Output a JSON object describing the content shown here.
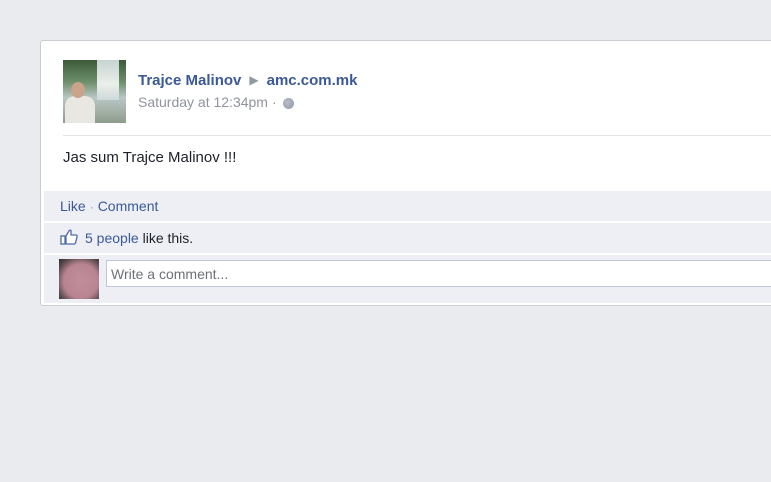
{
  "post": {
    "author": "Trajce Malinov",
    "target": "amc.com.mk",
    "timestamp": "Saturday at 12:34pm",
    "separator": "·",
    "privacy_icon": "globe-icon",
    "text": "Jas sum Trajce Malinov !!!"
  },
  "actions": {
    "like_label": "Like",
    "separator": "·",
    "comment_label": "Comment"
  },
  "likes": {
    "icon": "thumbs-up-icon",
    "people_link": "5 people",
    "suffix": "like this."
  },
  "comment_box": {
    "placeholder": "Write a comment..."
  },
  "colors": {
    "link": "#3b5998",
    "background": "#e9ebee",
    "panel": "#edeff4"
  }
}
